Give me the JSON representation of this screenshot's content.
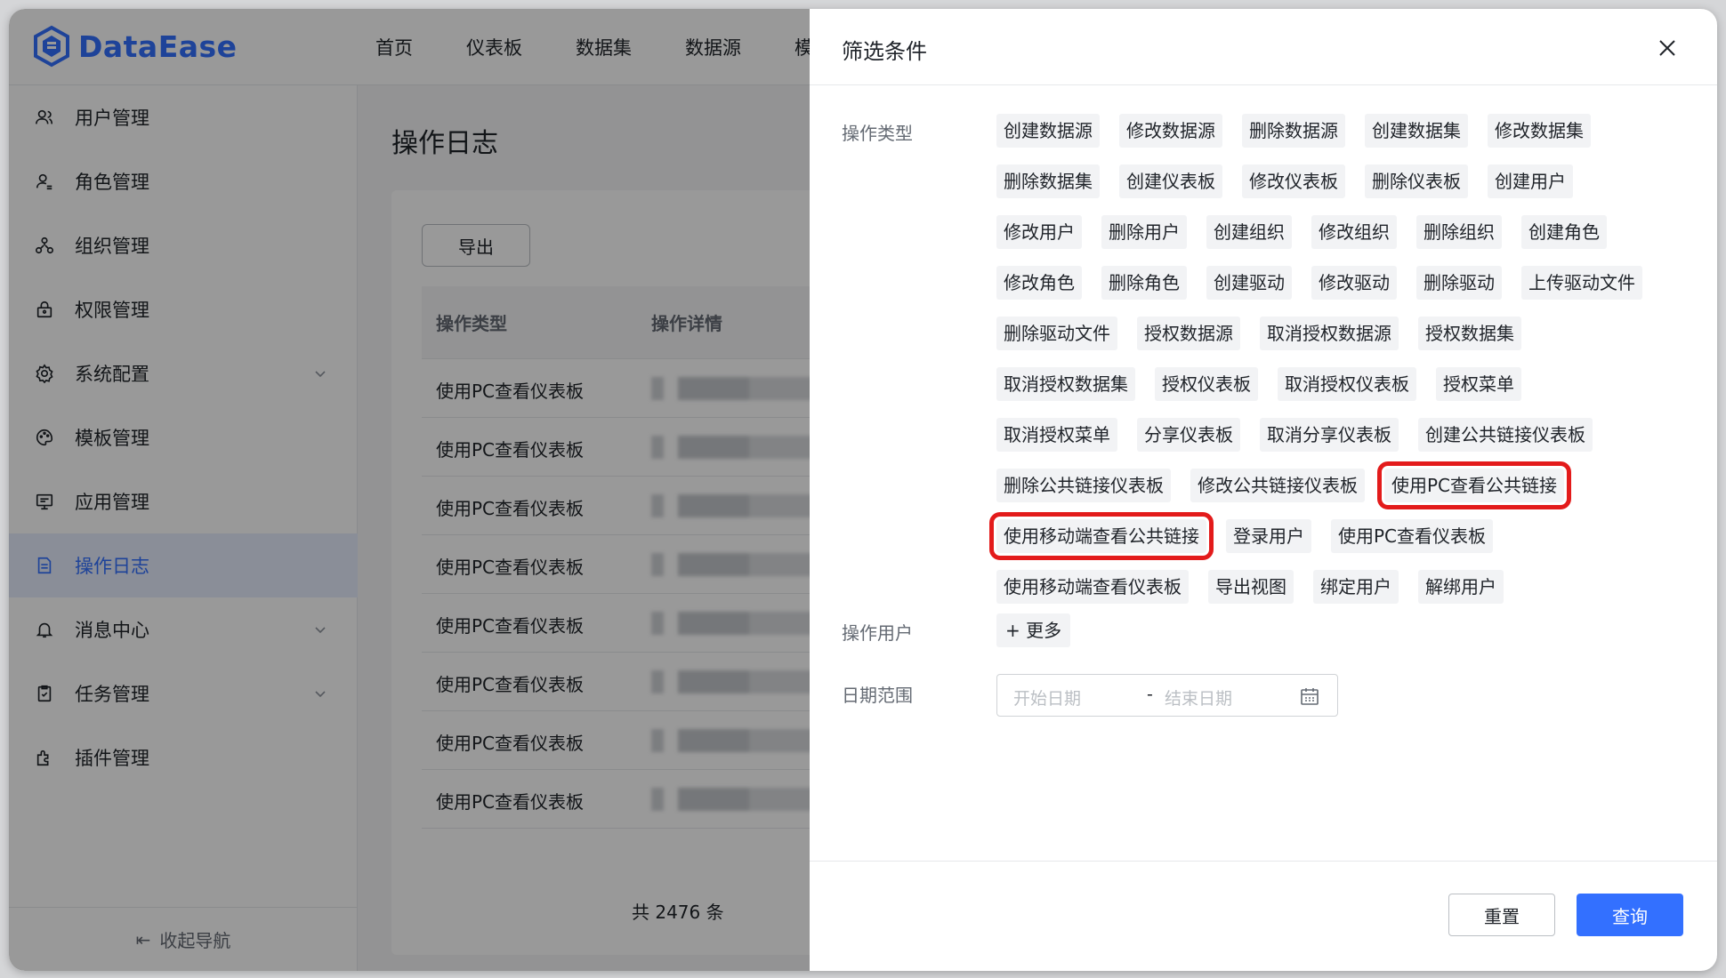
{
  "app": {
    "logo_text": "DataEase"
  },
  "nav": [
    "首页",
    "仪表板",
    "数据集",
    "数据源",
    "模"
  ],
  "sidebar": {
    "items": [
      {
        "label": "用户管理",
        "icon": "users-icon"
      },
      {
        "label": "角色管理",
        "icon": "role-icon"
      },
      {
        "label": "组织管理",
        "icon": "org-icon"
      },
      {
        "label": "权限管理",
        "icon": "lock-icon"
      },
      {
        "label": "系统配置",
        "icon": "gear-icon",
        "expandable": true
      },
      {
        "label": "模板管理",
        "icon": "palette-icon"
      },
      {
        "label": "应用管理",
        "icon": "monitor-icon"
      },
      {
        "label": "操作日志",
        "icon": "document-icon",
        "active": true
      },
      {
        "label": "消息中心",
        "icon": "bell-icon",
        "expandable": true
      },
      {
        "label": "任务管理",
        "icon": "clipboard-icon",
        "expandable": true
      },
      {
        "label": "插件管理",
        "icon": "plugin-icon"
      }
    ],
    "collapse_label": "收起导航"
  },
  "main": {
    "page_title": "操作日志",
    "export_label": "导出",
    "columns": [
      "操作类型",
      "操作详情"
    ],
    "rows": [
      "使用PC查看仪表板",
      "使用PC查看仪表板",
      "使用PC查看仪表板",
      "使用PC查看仪表板",
      "使用PC查看仪表板",
      "使用PC查看仪表板",
      "使用PC查看仪表板",
      "使用PC查看仪表板"
    ],
    "total_text": "共 2476 条"
  },
  "drawer": {
    "title": "筛选条件",
    "op_type_label": "操作类型",
    "op_types": [
      "创建数据源",
      "修改数据源",
      "删除数据源",
      "创建数据集",
      "修改数据集",
      "删除数据集",
      "创建仪表板",
      "修改仪表板",
      "删除仪表板",
      "创建用户",
      "修改用户",
      "删除用户",
      "创建组织",
      "修改组织",
      "删除组织",
      "创建角色",
      "修改角色",
      "删除角色",
      "创建驱动",
      "修改驱动",
      "删除驱动",
      "上传驱动文件",
      "删除驱动文件",
      "授权数据源",
      "取消授权数据源",
      "授权数据集",
      "取消授权数据集",
      "授权仪表板",
      "取消授权仪表板",
      "授权菜单",
      "取消授权菜单",
      "分享仪表板",
      "取消分享仪表板",
      "创建公共链接仪表板",
      "删除公共链接仪表板",
      "修改公共链接仪表板",
      "使用PC查看公共链接",
      "使用移动端查看公共链接",
      "登录用户",
      "使用PC查看仪表板",
      "使用移动端查看仪表板",
      "导出视图",
      "绑定用户",
      "解绑用户"
    ],
    "highlighted": [
      "使用PC查看公共链接",
      "使用移动端查看公共链接"
    ],
    "op_user_label": "操作用户",
    "more_label": "+ 更多",
    "date_label": "日期范围",
    "start_placeholder": "开始日期",
    "date_separator": "-",
    "end_placeholder": "结束日期",
    "reset_label": "重置",
    "query_label": "查询"
  },
  "colors": {
    "accent": "#3370ff",
    "highlight_box": "#e31b1b"
  }
}
